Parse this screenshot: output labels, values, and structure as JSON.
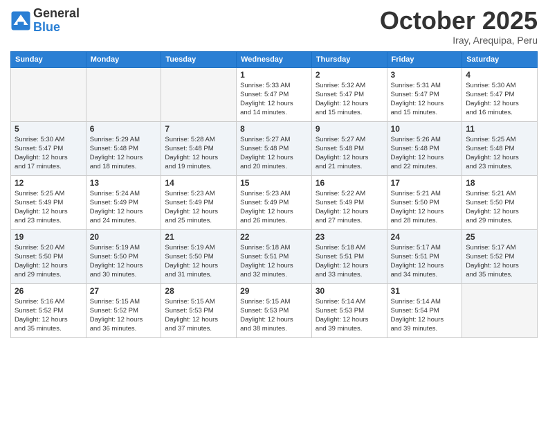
{
  "header": {
    "logo_general": "General",
    "logo_blue": "Blue",
    "month_title": "October 2025",
    "location": "Iray, Arequipa, Peru"
  },
  "weekdays": [
    "Sunday",
    "Monday",
    "Tuesday",
    "Wednesday",
    "Thursday",
    "Friday",
    "Saturday"
  ],
  "weeks": [
    [
      {
        "day": "",
        "info": ""
      },
      {
        "day": "",
        "info": ""
      },
      {
        "day": "",
        "info": ""
      },
      {
        "day": "1",
        "info": "Sunrise: 5:33 AM\nSunset: 5:47 PM\nDaylight: 12 hours\nand 14 minutes."
      },
      {
        "day": "2",
        "info": "Sunrise: 5:32 AM\nSunset: 5:47 PM\nDaylight: 12 hours\nand 15 minutes."
      },
      {
        "day": "3",
        "info": "Sunrise: 5:31 AM\nSunset: 5:47 PM\nDaylight: 12 hours\nand 15 minutes."
      },
      {
        "day": "4",
        "info": "Sunrise: 5:30 AM\nSunset: 5:47 PM\nDaylight: 12 hours\nand 16 minutes."
      }
    ],
    [
      {
        "day": "5",
        "info": "Sunrise: 5:30 AM\nSunset: 5:47 PM\nDaylight: 12 hours\nand 17 minutes."
      },
      {
        "day": "6",
        "info": "Sunrise: 5:29 AM\nSunset: 5:48 PM\nDaylight: 12 hours\nand 18 minutes."
      },
      {
        "day": "7",
        "info": "Sunrise: 5:28 AM\nSunset: 5:48 PM\nDaylight: 12 hours\nand 19 minutes."
      },
      {
        "day": "8",
        "info": "Sunrise: 5:27 AM\nSunset: 5:48 PM\nDaylight: 12 hours\nand 20 minutes."
      },
      {
        "day": "9",
        "info": "Sunrise: 5:27 AM\nSunset: 5:48 PM\nDaylight: 12 hours\nand 21 minutes."
      },
      {
        "day": "10",
        "info": "Sunrise: 5:26 AM\nSunset: 5:48 PM\nDaylight: 12 hours\nand 22 minutes."
      },
      {
        "day": "11",
        "info": "Sunrise: 5:25 AM\nSunset: 5:48 PM\nDaylight: 12 hours\nand 23 minutes."
      }
    ],
    [
      {
        "day": "12",
        "info": "Sunrise: 5:25 AM\nSunset: 5:49 PM\nDaylight: 12 hours\nand 23 minutes."
      },
      {
        "day": "13",
        "info": "Sunrise: 5:24 AM\nSunset: 5:49 PM\nDaylight: 12 hours\nand 24 minutes."
      },
      {
        "day": "14",
        "info": "Sunrise: 5:23 AM\nSunset: 5:49 PM\nDaylight: 12 hours\nand 25 minutes."
      },
      {
        "day": "15",
        "info": "Sunrise: 5:23 AM\nSunset: 5:49 PM\nDaylight: 12 hours\nand 26 minutes."
      },
      {
        "day": "16",
        "info": "Sunrise: 5:22 AM\nSunset: 5:49 PM\nDaylight: 12 hours\nand 27 minutes."
      },
      {
        "day": "17",
        "info": "Sunrise: 5:21 AM\nSunset: 5:50 PM\nDaylight: 12 hours\nand 28 minutes."
      },
      {
        "day": "18",
        "info": "Sunrise: 5:21 AM\nSunset: 5:50 PM\nDaylight: 12 hours\nand 29 minutes."
      }
    ],
    [
      {
        "day": "19",
        "info": "Sunrise: 5:20 AM\nSunset: 5:50 PM\nDaylight: 12 hours\nand 29 minutes."
      },
      {
        "day": "20",
        "info": "Sunrise: 5:19 AM\nSunset: 5:50 PM\nDaylight: 12 hours\nand 30 minutes."
      },
      {
        "day": "21",
        "info": "Sunrise: 5:19 AM\nSunset: 5:50 PM\nDaylight: 12 hours\nand 31 minutes."
      },
      {
        "day": "22",
        "info": "Sunrise: 5:18 AM\nSunset: 5:51 PM\nDaylight: 12 hours\nand 32 minutes."
      },
      {
        "day": "23",
        "info": "Sunrise: 5:18 AM\nSunset: 5:51 PM\nDaylight: 12 hours\nand 33 minutes."
      },
      {
        "day": "24",
        "info": "Sunrise: 5:17 AM\nSunset: 5:51 PM\nDaylight: 12 hours\nand 34 minutes."
      },
      {
        "day": "25",
        "info": "Sunrise: 5:17 AM\nSunset: 5:52 PM\nDaylight: 12 hours\nand 35 minutes."
      }
    ],
    [
      {
        "day": "26",
        "info": "Sunrise: 5:16 AM\nSunset: 5:52 PM\nDaylight: 12 hours\nand 35 minutes."
      },
      {
        "day": "27",
        "info": "Sunrise: 5:15 AM\nSunset: 5:52 PM\nDaylight: 12 hours\nand 36 minutes."
      },
      {
        "day": "28",
        "info": "Sunrise: 5:15 AM\nSunset: 5:53 PM\nDaylight: 12 hours\nand 37 minutes."
      },
      {
        "day": "29",
        "info": "Sunrise: 5:15 AM\nSunset: 5:53 PM\nDaylight: 12 hours\nand 38 minutes."
      },
      {
        "day": "30",
        "info": "Sunrise: 5:14 AM\nSunset: 5:53 PM\nDaylight: 12 hours\nand 39 minutes."
      },
      {
        "day": "31",
        "info": "Sunrise: 5:14 AM\nSunset: 5:54 PM\nDaylight: 12 hours\nand 39 minutes."
      },
      {
        "day": "",
        "info": ""
      }
    ]
  ]
}
